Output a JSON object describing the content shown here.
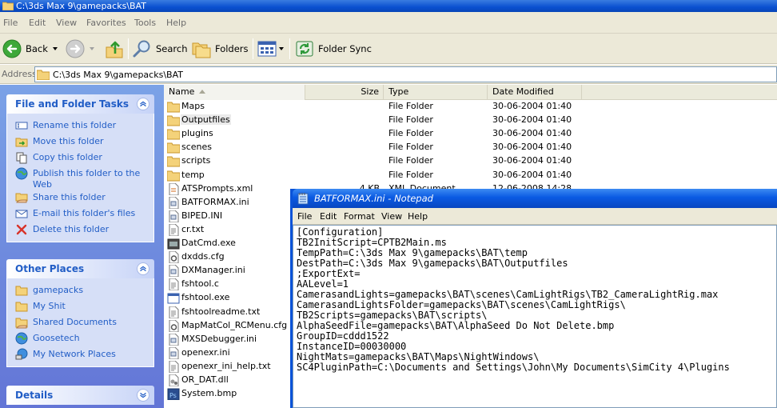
{
  "window": {
    "title": "C:\\3ds Max 9\\gamepacks\\BAT"
  },
  "menubar": [
    "File",
    "Edit",
    "View",
    "Favorites",
    "Tools",
    "Help"
  ],
  "toolbar": {
    "back": "Back",
    "search": "Search",
    "folders": "Folders",
    "folder_sync": "Folder Sync"
  },
  "address": {
    "label": "Address",
    "value": "C:\\3ds Max 9\\gamepacks\\BAT"
  },
  "tasks_panel": {
    "title": "File and Folder Tasks",
    "items": [
      "Rename this folder",
      "Move this folder",
      "Copy this folder",
      "Publish this folder to the Web",
      "Share this folder",
      "E-mail this folder's files",
      "Delete this folder"
    ]
  },
  "places_panel": {
    "title": "Other Places",
    "items": [
      "gamepacks",
      "My Shit",
      "Shared Documents",
      "Goosetech",
      "My Network Places"
    ]
  },
  "details_panel": {
    "title": "Details"
  },
  "columns": {
    "name": "Name",
    "size": "Size",
    "type": "Type",
    "date": "Date Modified"
  },
  "files": [
    {
      "name": "Maps",
      "size": "",
      "type": "File Folder",
      "date": "30-06-2004 01:40",
      "icon": "folder-icon"
    },
    {
      "name": "Outputfiles",
      "size": "",
      "type": "File Folder",
      "date": "30-06-2004 01:40",
      "icon": "folder-icon"
    },
    {
      "name": "plugins",
      "size": "",
      "type": "File Folder",
      "date": "30-06-2004 01:40",
      "icon": "folder-icon"
    },
    {
      "name": "scenes",
      "size": "",
      "type": "File Folder",
      "date": "30-06-2004 01:40",
      "icon": "folder-icon"
    },
    {
      "name": "scripts",
      "size": "",
      "type": "File Folder",
      "date": "30-06-2004 01:40",
      "icon": "folder-icon"
    },
    {
      "name": "temp",
      "size": "",
      "type": "File Folder",
      "date": "30-06-2004 01:40",
      "icon": "folder-icon"
    },
    {
      "name": "ATSPrompts.xml",
      "size": "4 KB",
      "type": "XML Document",
      "date": "12-06-2008 14:28",
      "icon": "xml-file-icon"
    },
    {
      "name": "BATFORMAX.ini",
      "size": "",
      "type": "",
      "date": "",
      "icon": "ini-file-icon"
    },
    {
      "name": "BIPED.INI",
      "size": "",
      "type": "",
      "date": "",
      "icon": "ini-file-icon"
    },
    {
      "name": "cr.txt",
      "size": "",
      "type": "",
      "date": "",
      "icon": "text-file-icon"
    },
    {
      "name": "DatCmd.exe",
      "size": "",
      "type": "",
      "date": "",
      "icon": "exe-file-icon"
    },
    {
      "name": "dxdds.cfg",
      "size": "",
      "type": "",
      "date": "",
      "icon": "cfg-file-icon"
    },
    {
      "name": "DXManager.ini",
      "size": "",
      "type": "",
      "date": "",
      "icon": "ini-file-icon"
    },
    {
      "name": "fshtool.c",
      "size": "",
      "type": "",
      "date": "",
      "icon": "text-file-icon"
    },
    {
      "name": "fshtool.exe",
      "size": "",
      "type": "",
      "date": "",
      "icon": "exe-window-icon"
    },
    {
      "name": "fshtoolreadme.txt",
      "size": "",
      "type": "",
      "date": "",
      "icon": "text-file-icon"
    },
    {
      "name": "MapMatCol_RCMenu.cfg",
      "size": "",
      "type": "",
      "date": "",
      "icon": "cfg-file-icon"
    },
    {
      "name": "MXSDebugger.ini",
      "size": "",
      "type": "",
      "date": "",
      "icon": "ini-file-icon"
    },
    {
      "name": "openexr.ini",
      "size": "",
      "type": "",
      "date": "",
      "icon": "ini-file-icon"
    },
    {
      "name": "openexr_ini_help.txt",
      "size": "",
      "type": "",
      "date": "",
      "icon": "text-file-icon"
    },
    {
      "name": "OR_DAT.dll",
      "size": "",
      "type": "",
      "date": "",
      "icon": "dll-file-icon"
    },
    {
      "name": "System.bmp",
      "size": "",
      "type": "",
      "date": "",
      "icon": "photoshop-file-icon"
    }
  ],
  "notepad": {
    "title": "BATFORMAX.ini - Notepad",
    "menu": [
      "File",
      "Edit",
      "Format",
      "View",
      "Help"
    ],
    "lines": [
      "[Configuration]",
      "TB2InitScript=CPTB2Main.ms",
      "TempPath=C:\\3ds Max 9\\gamepacks\\BAT\\temp",
      "DestPath=C:\\3ds Max 9\\gamepacks\\BAT\\Outputfiles",
      ";ExportExt=",
      "AALevel=1",
      "CamerasandLights=gamepacks\\BAT\\scenes\\CamLightRigs\\TB2_CameraLightRig.max",
      "CamerasandLightsFolder=gamepacks\\BAT\\scenes\\CamLightRigs\\",
      "TB2Scripts=gamepacks\\BAT\\scripts\\",
      "AlphaSeedFile=gamepacks\\BAT\\AlphaSeed Do Not Delete.bmp",
      "GroupID=cddd1522",
      "InstanceID=00030000",
      "NightMats=gamepacks\\BAT\\Maps\\NightWindows\\",
      "SC4PluginPath=C:\\Documents and Settings\\John\\My Documents\\SimCity 4\\Plugins"
    ]
  }
}
